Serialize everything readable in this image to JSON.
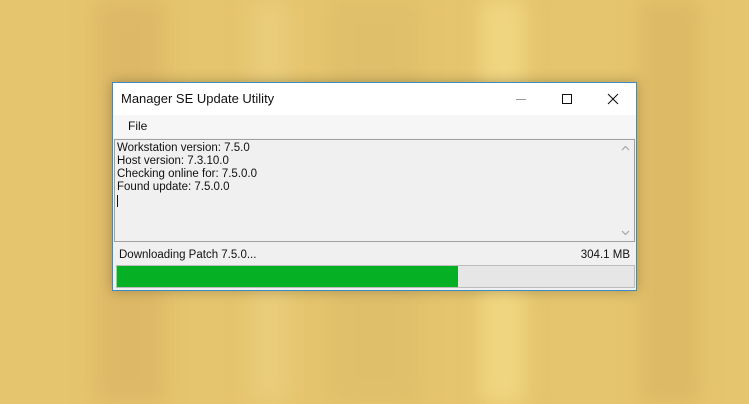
{
  "window": {
    "title": "Manager SE Update Utility",
    "controls": [
      "minimize-icon",
      "maximize-icon",
      "close-icon"
    ]
  },
  "menu": {
    "items": [
      {
        "label": "File"
      }
    ]
  },
  "log": {
    "lines": [
      "Workstation version: 7.5.0",
      "Host version: 7.3.10.0",
      "Checking online for: 7.5.0.0",
      "Found update: 7.5.0.0"
    ]
  },
  "status": {
    "text": "Downloading Patch 7.5.0...",
    "size": "304.1 MB",
    "progress": 0.66
  },
  "colors": {
    "desktop": "#e5c56d",
    "progress_fill": "#06b025",
    "window_border": "#3b8cc4"
  }
}
